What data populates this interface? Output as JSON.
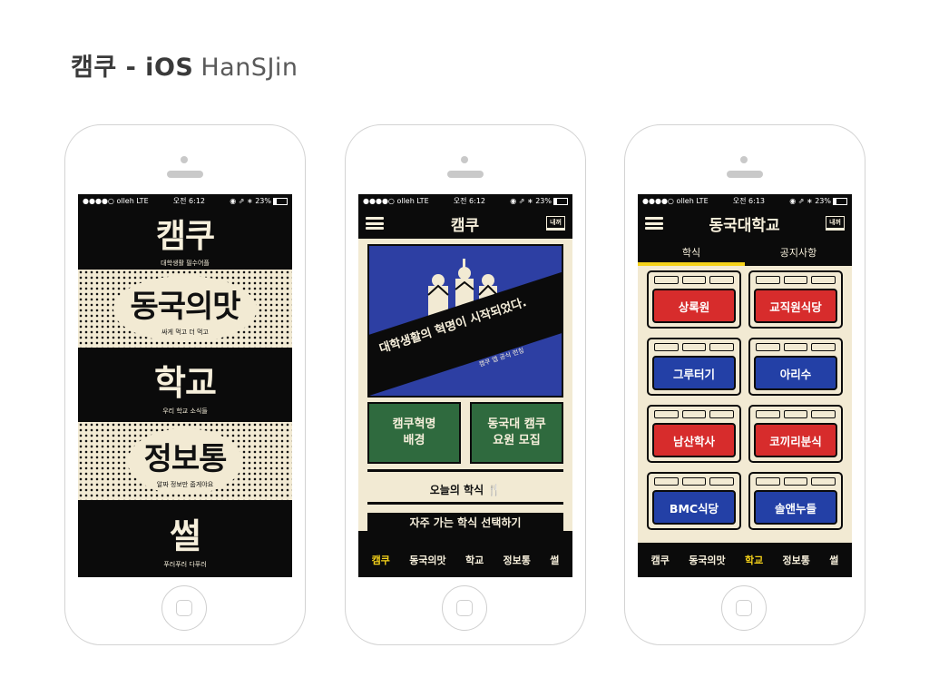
{
  "page": {
    "title_bold": "캠쿠 - iOS",
    "title_sub": "HanSJin"
  },
  "status": {
    "carrier": "●●●●○ olleh  LTE",
    "time1": "오전 6:12",
    "time2": "오전 6:12",
    "time3": "오전 6:13",
    "battery": "◉ ⇗ ∗ 23%"
  },
  "phone1": {
    "blocks": [
      {
        "title": "캠쿠",
        "caption": "대학생활 필수어플"
      },
      {
        "title": "동국의맛",
        "caption": "싸게 먹고 더 먹고"
      },
      {
        "title": "학교",
        "caption": "우리 학교 소식들"
      },
      {
        "title": "정보통",
        "caption": "알짜 정보만 줍게야요"
      },
      {
        "title": "썰",
        "caption": "푸러푸러 다푸러"
      }
    ]
  },
  "phone2": {
    "header_title": "캠쿠",
    "mine_label": "내꺼",
    "poster_title": "대학생활의 혁명이 시작되었다.",
    "poster_sub": "캠쿠 앱 공식 런칭",
    "tile_left": "캠쿠혁명\n배경",
    "tile_right": "동국대 캠쿠\n요원 모집",
    "today_meal": "오늘의 학식 🍴",
    "choose_meal": "자주 가는 학식 선택하기",
    "tabs": [
      "캠쿠",
      "동국의맛",
      "학교",
      "정보통",
      "썰"
    ],
    "active_tab": 0
  },
  "phone3": {
    "header_title": "동국대학교",
    "mine_label": "내꺼",
    "segments": [
      "학식",
      "공지사항"
    ],
    "cafeterias": [
      {
        "name": "상록원",
        "color": "red"
      },
      {
        "name": "교직원식당",
        "color": "red"
      },
      {
        "name": "그루터기",
        "color": "blue"
      },
      {
        "name": "아리수",
        "color": "blue"
      },
      {
        "name": "남산학사",
        "color": "red"
      },
      {
        "name": "코끼리분식",
        "color": "red"
      },
      {
        "name": "BMC식당",
        "color": "blue"
      },
      {
        "name": "솔앤누들",
        "color": "blue"
      }
    ],
    "tabs": [
      "캠쿠",
      "동국의맛",
      "학교",
      "정보통",
      "썰"
    ],
    "active_tab": 2
  },
  "colors": {
    "dark": "#0b0b0b",
    "cream": "#f2ead3",
    "accent_yellow": "#f5d21a",
    "red": "#d72c2c",
    "blue": "#2340a6",
    "green": "#2f6a3e"
  }
}
